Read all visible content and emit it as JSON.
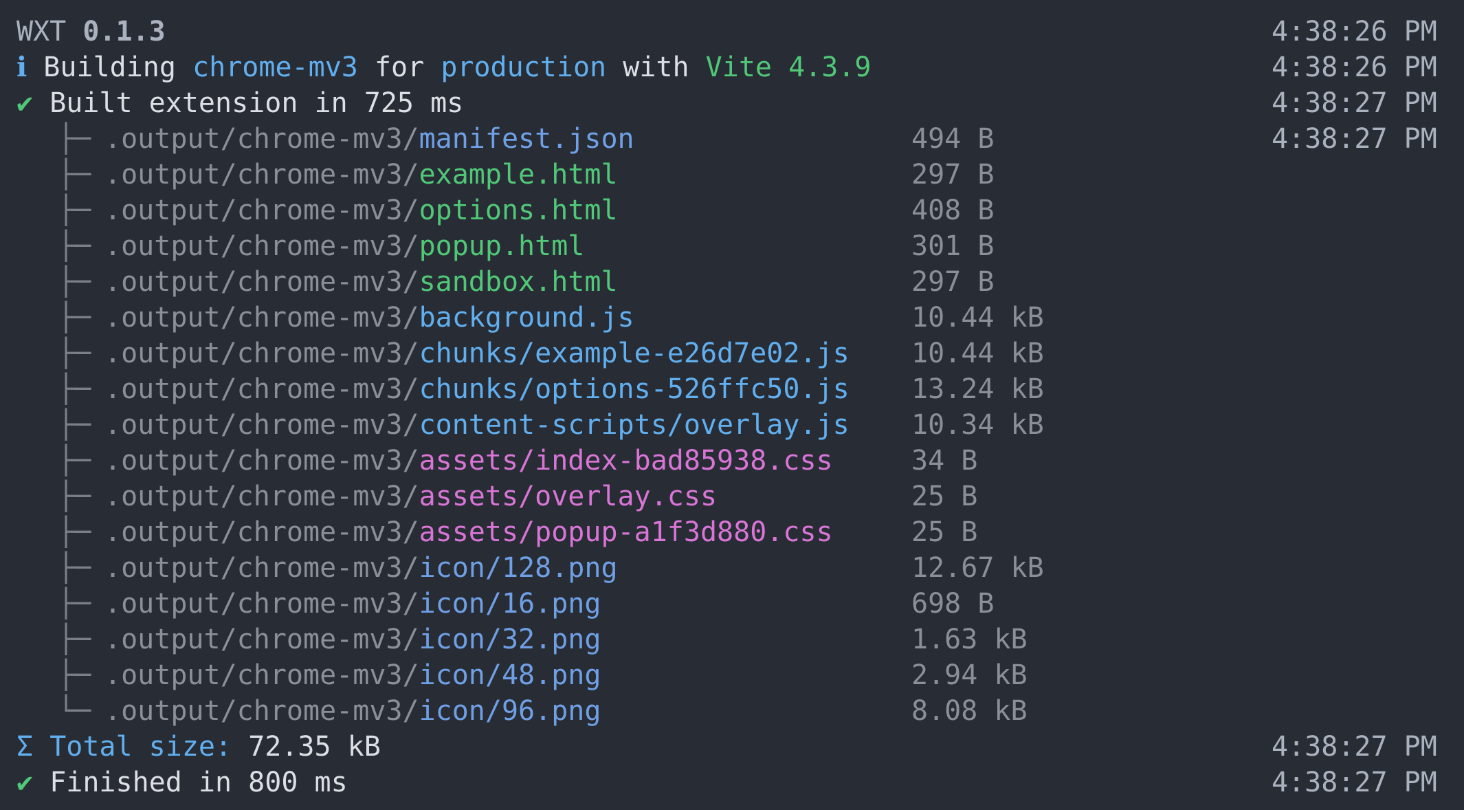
{
  "colors": {
    "background": "#282c34",
    "text": "#dcdfe4",
    "muted": "#8a8f98",
    "html": "#50c878",
    "js": "#61afef",
    "css": "#d875d6",
    "png": "#6fa0e6",
    "json": "#6fa0e6"
  },
  "header": {
    "app_name": "WXT",
    "version": "0.1.3",
    "time": "4:38:26 PM"
  },
  "build_line": {
    "icon": "info-icon",
    "icon_glyph": "ℹ",
    "prefix": "Building",
    "target": "chrome-mv3",
    "word_for": "for",
    "mode": "production",
    "word_with": "with",
    "bundler": "Vite 4.3.9",
    "time": "4:38:26 PM"
  },
  "built_line": {
    "icon": "check-icon",
    "icon_glyph": "✔",
    "text": "Built extension in 725 ms",
    "time": "4:38:27 PM"
  },
  "output_prefix": ".output/chrome-mv3/",
  "files": [
    {
      "tree": "├─",
      "name": "manifest.json",
      "size": "494 B",
      "type": "json",
      "time": "4:38:27 PM"
    },
    {
      "tree": "├─",
      "name": "example.html",
      "size": "297 B",
      "type": "html"
    },
    {
      "tree": "├─",
      "name": "options.html",
      "size": "408 B",
      "type": "html"
    },
    {
      "tree": "├─",
      "name": "popup.html",
      "size": "301 B",
      "type": "html"
    },
    {
      "tree": "├─",
      "name": "sandbox.html",
      "size": "297 B",
      "type": "html"
    },
    {
      "tree": "├─",
      "name": "background.js",
      "size": "10.44 kB",
      "type": "js"
    },
    {
      "tree": "├─",
      "name": "chunks/example-e26d7e02.js",
      "size": "10.44 kB",
      "type": "js"
    },
    {
      "tree": "├─",
      "name": "chunks/options-526ffc50.js",
      "size": "13.24 kB",
      "type": "js"
    },
    {
      "tree": "├─",
      "name": "content-scripts/overlay.js",
      "size": "10.34 kB",
      "type": "js"
    },
    {
      "tree": "├─",
      "name": "assets/index-bad85938.css",
      "size": "34 B",
      "type": "css"
    },
    {
      "tree": "├─",
      "name": "assets/overlay.css",
      "size": "25 B",
      "type": "css"
    },
    {
      "tree": "├─",
      "name": "assets/popup-a1f3d880.css",
      "size": "25 B",
      "type": "css"
    },
    {
      "tree": "├─",
      "name": "icon/128.png",
      "size": "12.67 kB",
      "type": "png"
    },
    {
      "tree": "├─",
      "name": "icon/16.png",
      "size": "698 B",
      "type": "png"
    },
    {
      "tree": "├─",
      "name": "icon/32.png",
      "size": "1.63 kB",
      "type": "png"
    },
    {
      "tree": "├─",
      "name": "icon/48.png",
      "size": "2.94 kB",
      "type": "png"
    },
    {
      "tree": "└─",
      "name": "icon/96.png",
      "size": "8.08 kB",
      "type": "png"
    }
  ],
  "total_line": {
    "icon": "sigma-icon",
    "icon_glyph": "Σ",
    "label": "Total size:",
    "value": "72.35 kB",
    "time": "4:38:27 PM"
  },
  "finished_line": {
    "icon": "check-icon",
    "icon_glyph": "✔",
    "text": "Finished in 800 ms",
    "time": "4:38:27 PM"
  }
}
